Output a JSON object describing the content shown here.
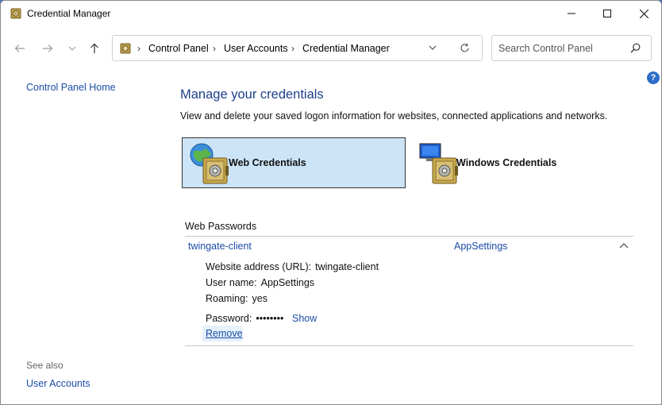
{
  "window": {
    "title": "Credential Manager"
  },
  "breadcrumb": [
    "Control Panel",
    "User Accounts",
    "Credential Manager"
  ],
  "search": {
    "placeholder": "Search Control Panel"
  },
  "left_nav": {
    "home": "Control Panel Home",
    "see_also": "See also",
    "user_accounts": "User Accounts"
  },
  "main": {
    "heading": "Manage your credentials",
    "description": "View and delete your saved logon information for websites, connected applications and networks.",
    "tiles": {
      "web": "Web Credentials",
      "windows": "Windows Credentials"
    },
    "section_title": "Web Passwords",
    "entry": {
      "name": "twingate-client",
      "user": "AppSettings",
      "url_label": "Website address (URL):",
      "url_value": "twingate-client",
      "username_label": "User name:",
      "username_value": "AppSettings",
      "roaming_label": "Roaming:",
      "roaming_value": "yes",
      "password_label": "Password:",
      "password_value": "••••••••",
      "show_label": "Show",
      "remove_label": "Remove"
    }
  },
  "help": "?",
  "icons": [
    "credential-manager-icon",
    "minimize-icon",
    "maximize-icon",
    "close-icon",
    "back-icon",
    "forward-icon",
    "recent-dropdown-icon",
    "up-icon",
    "control-panel-icon",
    "chevron-right-icon",
    "address-dropdown-icon",
    "refresh-icon",
    "search-icon",
    "help-icon",
    "web-vault-icon",
    "windows-vault-icon",
    "chevron-up-icon"
  ],
  "colors": {
    "accent": "#1b4ca6",
    "heading": "#1e3f8a",
    "selected_tile": "#cce4f7"
  }
}
